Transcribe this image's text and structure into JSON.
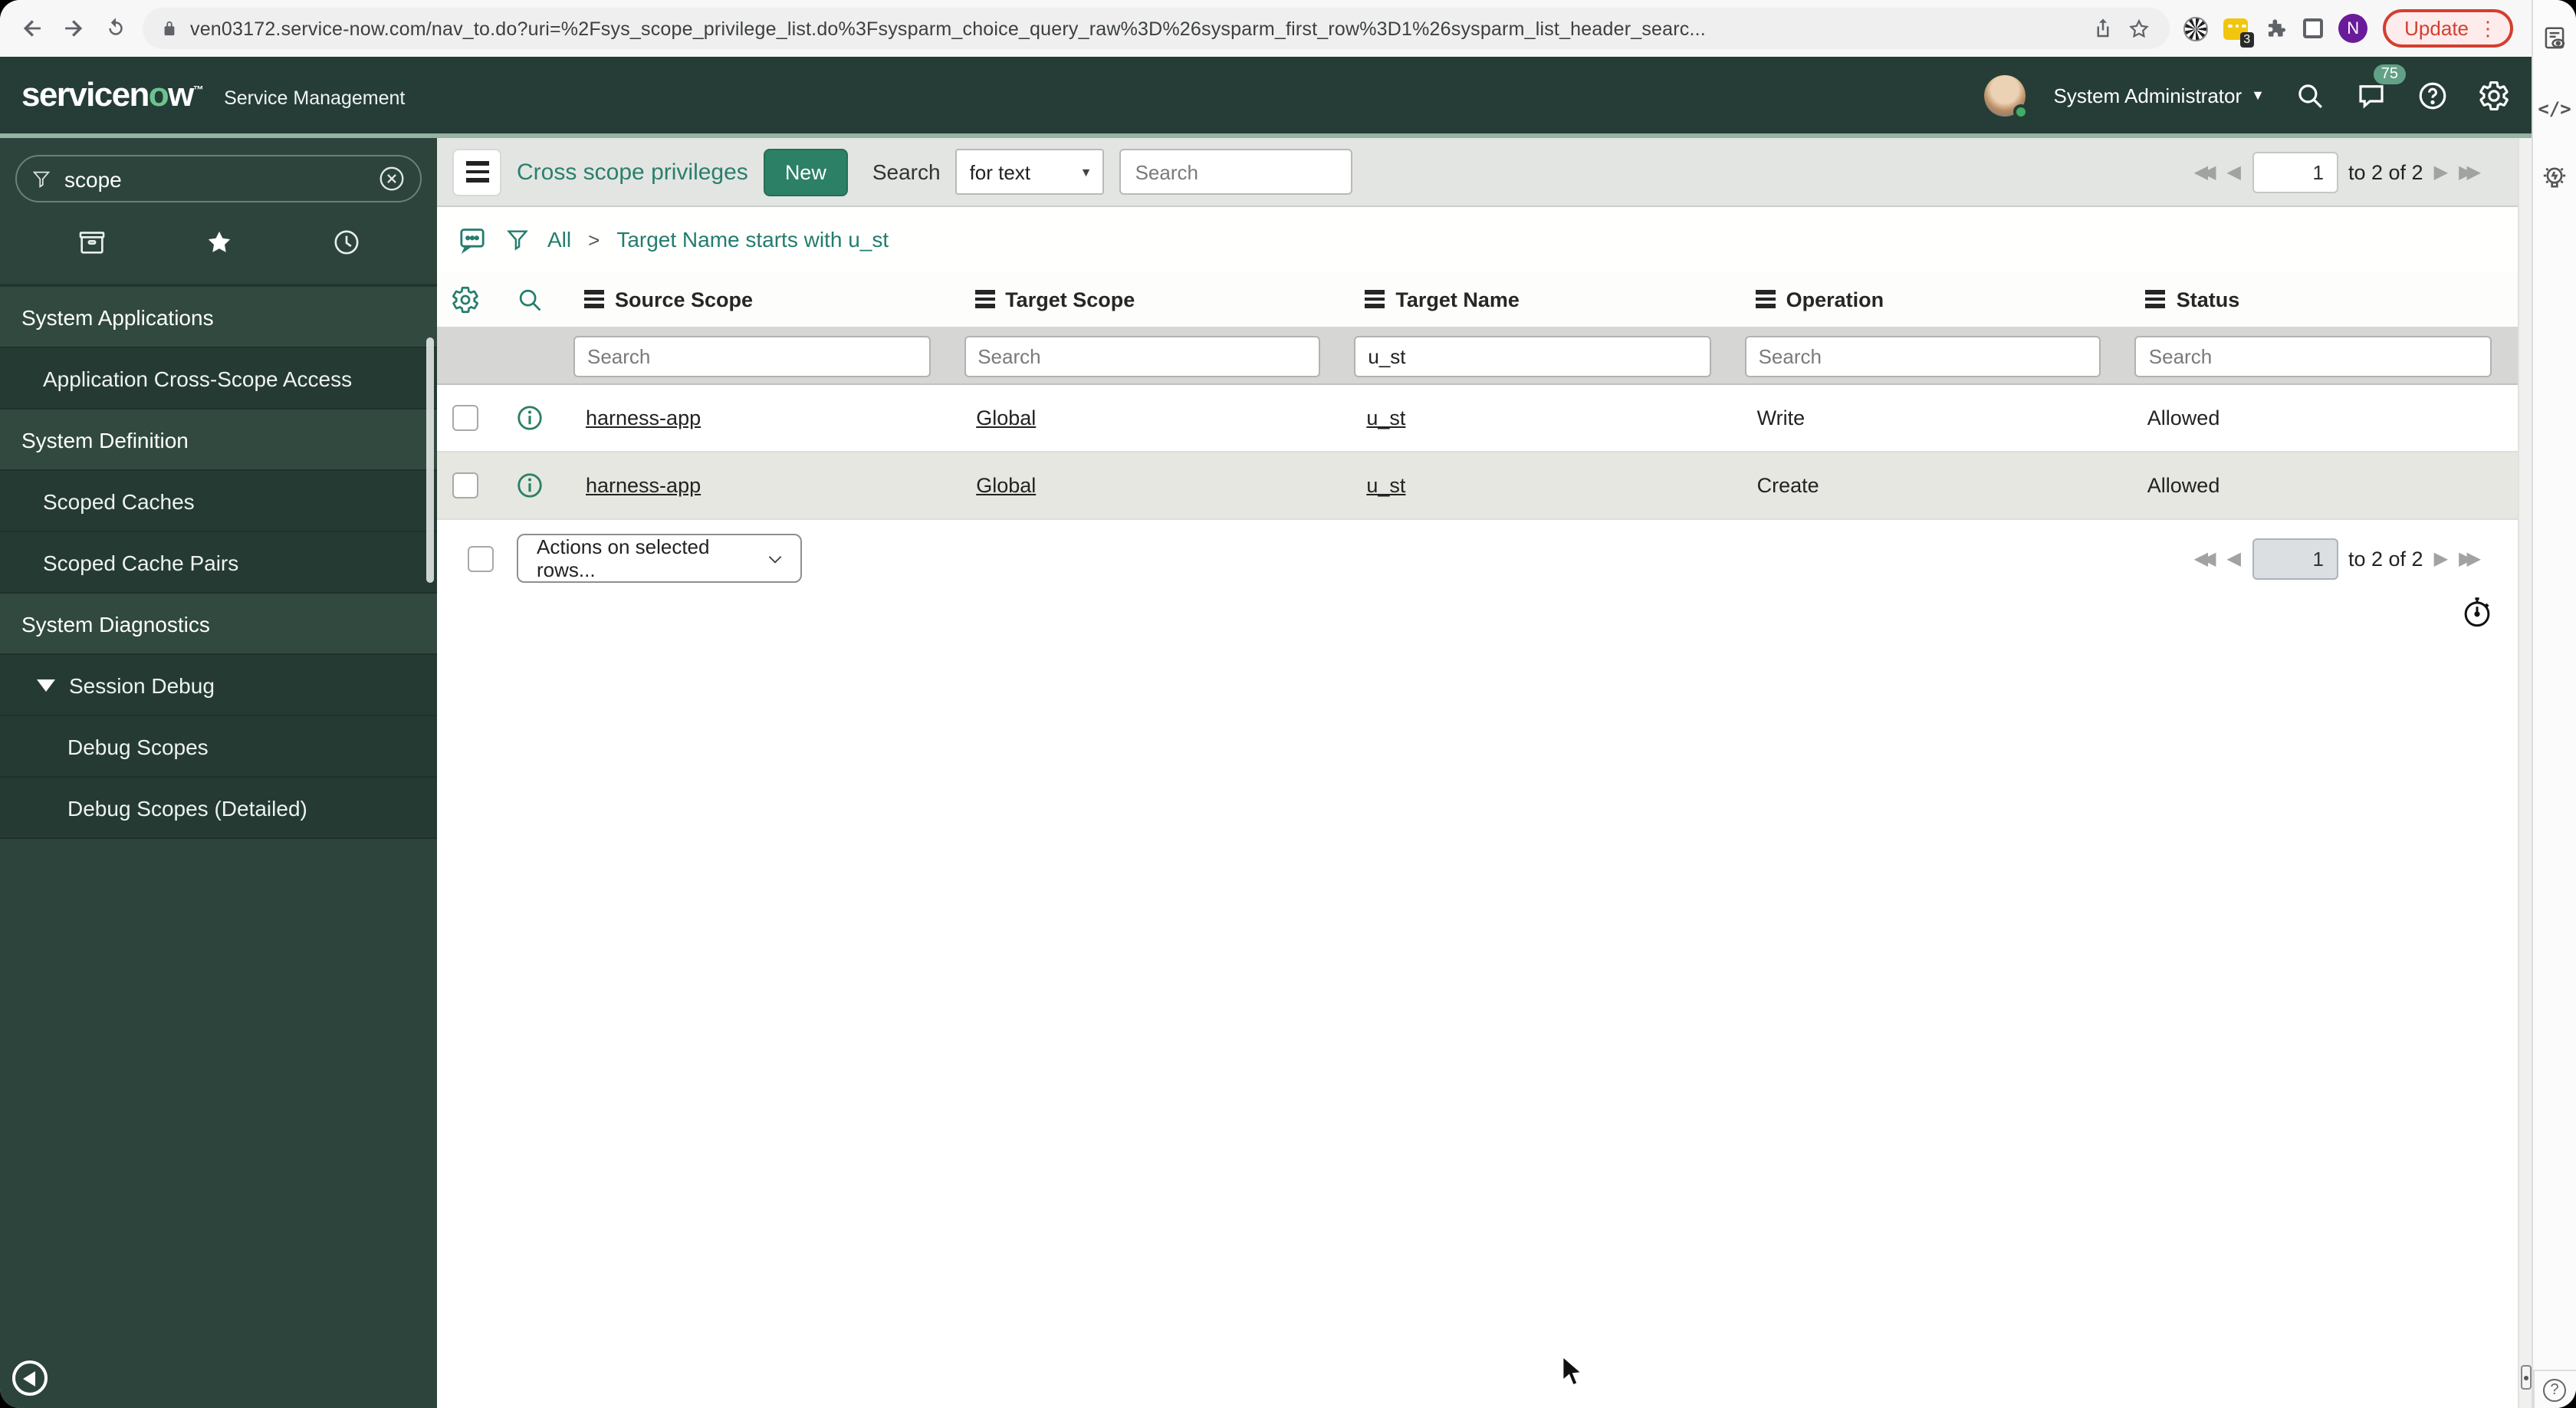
{
  "browser": {
    "url": "ven03172.service-now.com/nav_to.do?uri=%2Fsys_scope_privilege_list.do%3Fsysparm_choice_query_raw%3D%26sysparm_first_row%3D1%26sysparm_list_header_searc...",
    "update_label": "Update",
    "profile_initial": "N",
    "extension_badge": "3"
  },
  "header": {
    "logo_pre": "servicen",
    "logo_o": "o",
    "logo_post": "w",
    "product": "Service Management",
    "user": "System Administrator",
    "notification_count": "75"
  },
  "sidebar": {
    "search_value": "scope",
    "items": [
      {
        "label": "System Applications",
        "type": "section"
      },
      {
        "label": "Application Cross-Scope Access",
        "type": "item"
      },
      {
        "label": "System Definition",
        "type": "section"
      },
      {
        "label": "Scoped Caches",
        "type": "item"
      },
      {
        "label": "Scoped Cache Pairs",
        "type": "item"
      },
      {
        "label": "System Diagnostics",
        "type": "section"
      },
      {
        "label": "Session Debug",
        "type": "item-expanded"
      },
      {
        "label": "Debug Scopes",
        "type": "subitem"
      },
      {
        "label": "Debug Scopes (Detailed)",
        "type": "subitem"
      }
    ]
  },
  "toolbar": {
    "title": "Cross scope privileges",
    "new_label": "New",
    "search_label": "Search",
    "search_type": "for text",
    "search_placeholder": "Search"
  },
  "breadcrumb": {
    "all": "All",
    "separator": ">",
    "filter": "Target Name starts with u_st"
  },
  "pagination": {
    "page": "1",
    "range": "to 2 of 2"
  },
  "table": {
    "columns": [
      "Source Scope",
      "Target Scope",
      "Target Name",
      "Operation",
      "Status"
    ],
    "filter_placeholder": "Search",
    "filters": {
      "target_name": "u_st"
    },
    "rows": [
      {
        "source_scope": "harness-app",
        "target_scope": "Global",
        "target_name": "u_st",
        "operation": "Write",
        "status": "Allowed"
      },
      {
        "source_scope": "harness-app",
        "target_scope": "Global",
        "target_name": "u_st",
        "operation": "Create",
        "status": "Allowed"
      }
    ]
  },
  "footer": {
    "actions_label": "Actions on selected rows..."
  }
}
